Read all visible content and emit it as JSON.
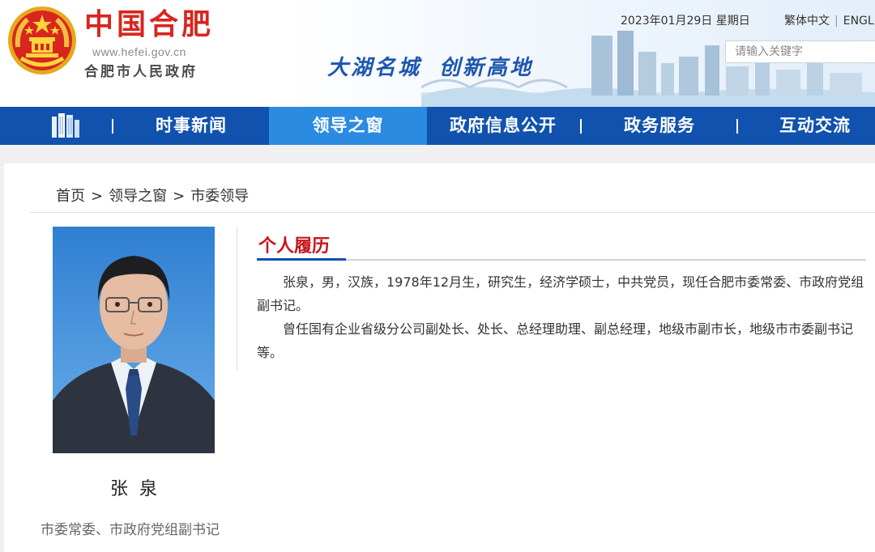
{
  "header": {
    "logo_title": "中国合肥",
    "logo_url": "www.hefei.gov.cn",
    "logo_subtitle": "合肥市人民政府",
    "slogan_part1": "大湖名城",
    "slogan_part2": "创新高地",
    "date": "2023年01月29日 星期日",
    "lang_traditional": "繁体中文",
    "lang_separator": "|",
    "lang_english": "ENGL",
    "search_placeholder": "请输入关键字"
  },
  "nav": {
    "items": [
      {
        "label": "时事新闻"
      },
      {
        "label": "领导之窗",
        "active": true
      },
      {
        "label": "政府信息公开"
      },
      {
        "label": "政务服务"
      },
      {
        "label": "互动交流"
      }
    ]
  },
  "breadcrumb": {
    "home": "首页",
    "section": "领导之窗",
    "current": "市委领导",
    "separator": ">"
  },
  "profile": {
    "name": "张泉",
    "position": "市委常委、市政府党组副书记"
  },
  "resume": {
    "title": "个人履历",
    "paragraphs": [
      "张泉，男，汉族，1978年12月生，研究生，经济学硕士，中共党员，现任合肥市委常委、市政府党组副书记。",
      "曾任国有企业省级分公司副处长、处长、总经理助理、副总经理，地级市副市长，地级市市委副书记等。"
    ]
  },
  "colors": {
    "nav_bg": "#1052ad",
    "nav_active": "#2a8be0",
    "logo_red": "#d8261e",
    "title_red": "#c8161d",
    "slogan_blue": "#1d57b0"
  }
}
